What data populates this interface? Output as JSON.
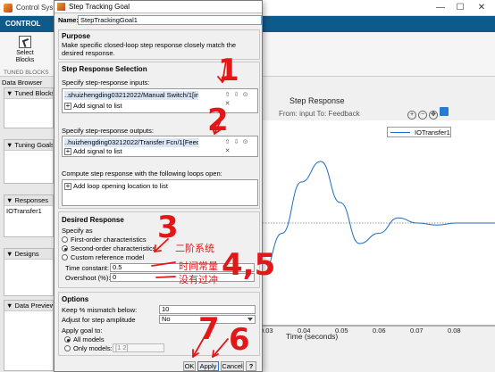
{
  "bg": {
    "title": "Control Sys",
    "tab": "CONTROL",
    "select_blocks": "Select\nBlocks",
    "tuned_blocks_group": "TUNED BLOCKS",
    "data_browser": "Data Browser",
    "sections": {
      "tuned": "Tuned Blocks",
      "tuning": "Tuning Goals",
      "responses": "Responses",
      "designs": "Designs",
      "data_preview": "Data Preview"
    },
    "response_item": "IOTransfer1"
  },
  "plot": {
    "title": "Step Response",
    "subtitle": "From: input  To: Feedback",
    "legend": "IOTransfer1",
    "xlabel": "Time (seconds)",
    "xticks": [
      "0.03",
      "0.04",
      "0.05",
      "0.06",
      "0.07",
      "0.08"
    ],
    "line_color": "#1b6dc1"
  },
  "chart_data": {
    "type": "line",
    "title": "Step Response",
    "xlabel": "Time (seconds)",
    "series": [
      {
        "name": "IOTransfer1",
        "x": [
          0.025,
          0.03,
          0.035,
          0.04,
          0.045,
          0.05,
          0.055,
          0.06,
          0.065,
          0.07,
          0.075,
          0.08,
          0.085
        ],
        "values": [
          0.95,
          0.99,
          1.04,
          1.06,
          1.02,
          0.98,
          0.99,
          1.005,
          1.0,
          0.998,
          1.0,
          1.0,
          1.0
        ]
      }
    ],
    "xlim": [
      0.025,
      0.085
    ],
    "ylim": [
      0.9,
      1.1
    ],
    "grid": false,
    "reference_line": "dashed"
  },
  "dialog": {
    "title": "Step Tracking Goal",
    "name_label": "Name:",
    "name_value": "StepTrackingGoal1",
    "purpose_title": "Purpose",
    "purpose_text": "Make specific closed-loop step response closely match the desired response.",
    "srs_title": "Step Response Selection",
    "inputs_label": "Specify step-response inputs:",
    "input_signal": "..shuizhengding03212022/Manual Switch/1[input]",
    "add_signal": "Add signal to list",
    "outputs_label": "Specify step-response outputs:",
    "output_signal": "..huizhengding03212022/Transfer Fcn/1[Feedback]",
    "loops_label": "Compute step response with the following loops open:",
    "add_loop": "Add loop opening location to list",
    "desired_title": "Desired Response",
    "specify_as": "Specify as",
    "opt_first": "First-order characteristics",
    "opt_second": "Second-order characteristics",
    "opt_custom": "Custom reference model",
    "selected_spec": "Second-order characteristics",
    "tc_label": "Time constant:",
    "tc_value": "0.5",
    "os_label": "Overshoot (%):",
    "os_value": "0",
    "options_title": "Options",
    "keep_label": "Keep % mismatch below:",
    "keep_value": "10",
    "adjust_label": "Adjust for step amplitude",
    "adjust_value": "No",
    "apply_goal_label": "Apply goal to:",
    "opt_all_models": "All models",
    "opt_only_models": "Only models:",
    "models_value": "[1 2]",
    "ok": "OK",
    "apply": "Apply",
    "cancel": "Cancel",
    "help": "?"
  },
  "annotations": {
    "n1": "1",
    "n2": "2",
    "n3": "3",
    "n45": "4,5",
    "n6": "6",
    "n7": "7",
    "second_order": "二阶系统",
    "time_constant": "时间常量",
    "no_overshoot": "没有过冲",
    "color": "#e21818"
  }
}
